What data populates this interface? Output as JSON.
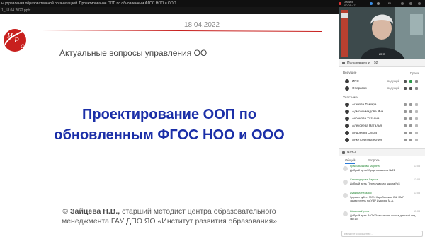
{
  "window": {
    "title": "ы управления образовательной организацией. Проектирование ООП по обновленным ФГОС НОО и ООО",
    "file_tab": "1_18.04.2022.pptx",
    "status": [
      "Запись",
      "00:05:47"
    ],
    "lang": "RU"
  },
  "slide": {
    "date": "18.04.2022",
    "subtitle": "Актуальные вопросы управления ОО",
    "title_line1": "Проектирование ООП по",
    "title_line2": "обновленным ФГОС НОО и ООО",
    "author_prefix": "© ",
    "author_name": "Зайцева Н.В.,",
    "author_line1_rest": " старший методист центра образовательного",
    "author_line2": "менеджмента ГАУ ДПО ЯО «Институт развития образования»",
    "logo_letters": "ИРО",
    "accent": "#c8201e",
    "title_color": "#1b2fa8"
  },
  "panel": {
    "users_label": "Пользователи",
    "users_count": "52",
    "leaders_label": "Ведущие",
    "rights_label": "Права",
    "leaders": [
      {
        "name": "ИРО",
        "role": "ведущий"
      },
      {
        "name": "Оператор",
        "role": "ведущий"
      }
    ],
    "participants_label": "Участники",
    "participants": [
      "Агапова Тамара",
      "Адмсольмидова Яна",
      "Аксенова Татьяна",
      "Алексеева Наталья",
      "Андреева Ольга",
      "Анкетсергова Юлия"
    ],
    "chat_label": "Чаты",
    "chat_tabs": [
      "Общий",
      "Вопросы"
    ],
    "messages": [
      {
        "who": "Красильникова Марина",
        "time": "13:03",
        "text": "Добрый день! Средняя школа №21"
      },
      {
        "who": "Склонодорова Лариса",
        "time": "13:03",
        "text": "Добрый день Переславская школа №3"
      },
      {
        "who": "Дудкина Наталья",
        "time": "13:03",
        "text": "Здравствуйте. МОУ Карабихская СШ ЯМР заместитель по УВР Дудкина М.А."
      },
      {
        "who": "Шишова Ирина",
        "time": "13:03",
        "text": "Добрый день. МОУ \"Начальная школа-детский сад №215\""
      }
    ],
    "input_placeholder": "Введите сообщение..."
  }
}
